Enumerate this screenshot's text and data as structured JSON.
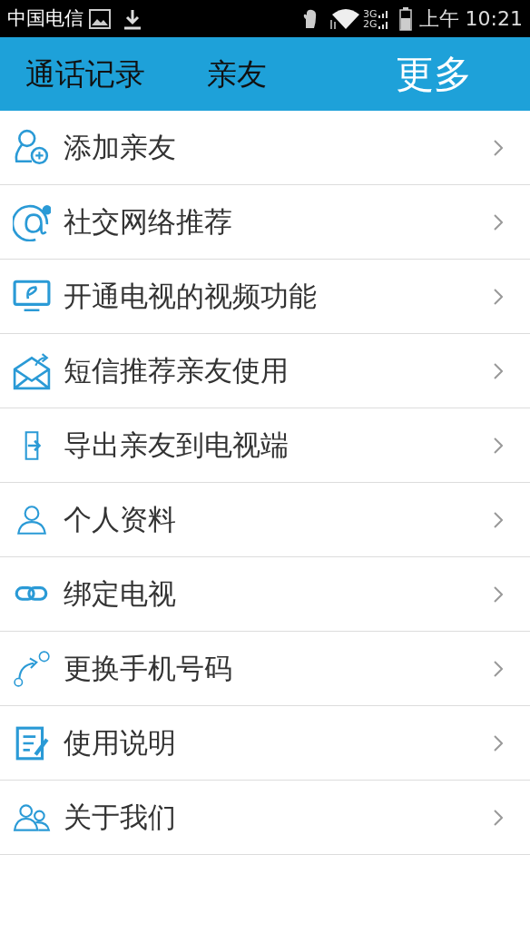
{
  "status_bar": {
    "carrier": "中国电信",
    "network_3g": "3G",
    "network_2g": "2G",
    "time": "上午 10:21"
  },
  "tabs": [
    {
      "label": "通话记录",
      "selected": false
    },
    {
      "label": "亲友",
      "selected": false
    },
    {
      "label": "更多",
      "selected": true
    }
  ],
  "menu_items": [
    {
      "kind": "add-person",
      "label": "添加亲友"
    },
    {
      "kind": "at",
      "label": "社交网络推荐"
    },
    {
      "kind": "tv",
      "label": "开通电视的视频功能"
    },
    {
      "kind": "mail",
      "label": "短信推荐亲友使用"
    },
    {
      "kind": "export",
      "label": "导出亲友到电视端"
    },
    {
      "kind": "person",
      "label": "个人资料"
    },
    {
      "kind": "link",
      "label": "绑定电视"
    },
    {
      "kind": "switch",
      "label": "更换手机号码"
    },
    {
      "kind": "notes",
      "label": "使用说明"
    },
    {
      "kind": "people",
      "label": "关于我们"
    }
  ]
}
